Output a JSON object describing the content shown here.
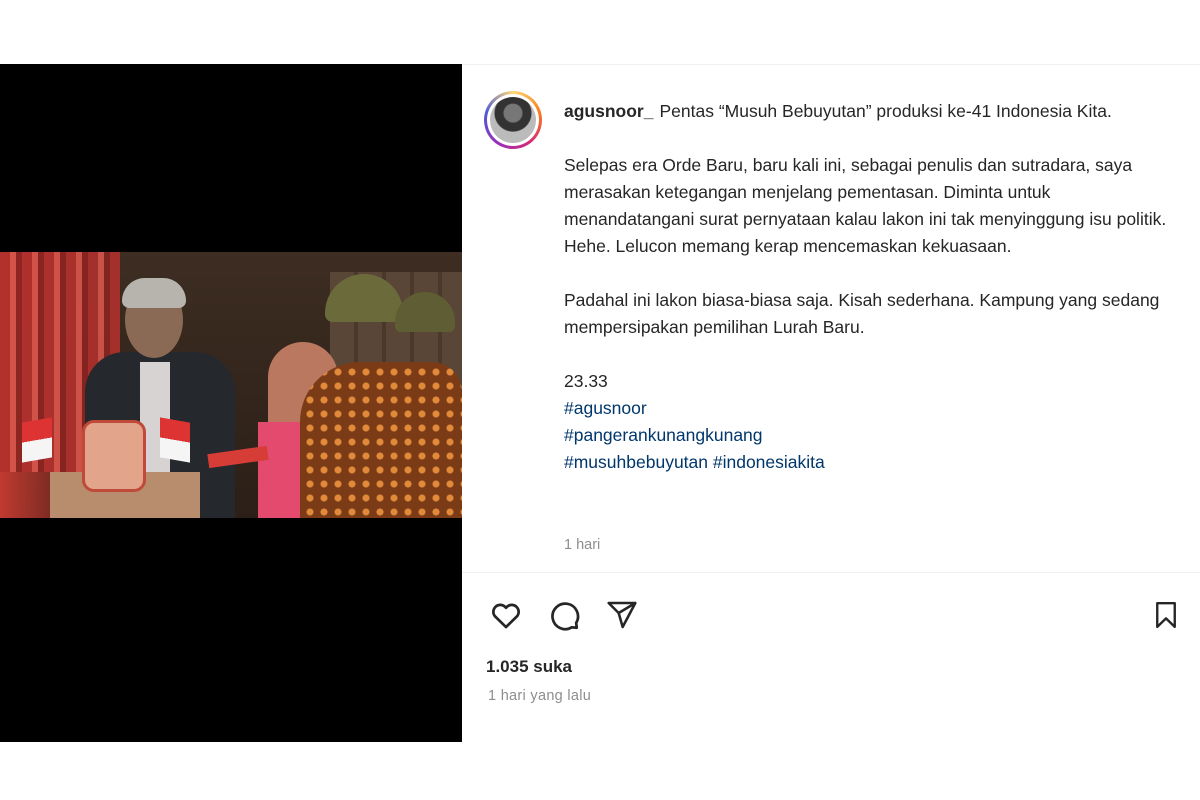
{
  "post": {
    "username": "agusnoor_",
    "caption_intro": "Pentas “Musuh Bebuyutan” produksi ke-41 Indonesia Kita.",
    "paragraph_1": "Selepas era Orde Baru, baru kali ini, sebagai penulis dan sutradara, saya merasakan ketegangan menjelang pementasan. Diminta untuk menandatangani surat pernyataan kalau lakon ini tak menyinggung isu politik. Hehe. Lelucon memang kerap mencemaskan kekuasaan.",
    "paragraph_2": "Padahal ini lakon biasa-biasa saja. Kisah sederhana. Kampung yang sedang mempersipakan pemilihan Lurah Baru.",
    "time_text": "23.33",
    "hashtags": [
      "#agusnoor",
      "#pangerankunangkunang",
      "#musuhbebuyutan #indonesiakita"
    ],
    "caption_age": "1 hari",
    "likes": "1.035 suka",
    "posted_ago": "1 hari yang lalu"
  },
  "icons": {
    "like": "heart-icon",
    "comment": "comment-icon",
    "share": "send-icon",
    "save": "bookmark-icon"
  },
  "colors": {
    "hashtag": "#00376b",
    "muted": "#8e8e8e",
    "text": "#262626"
  }
}
